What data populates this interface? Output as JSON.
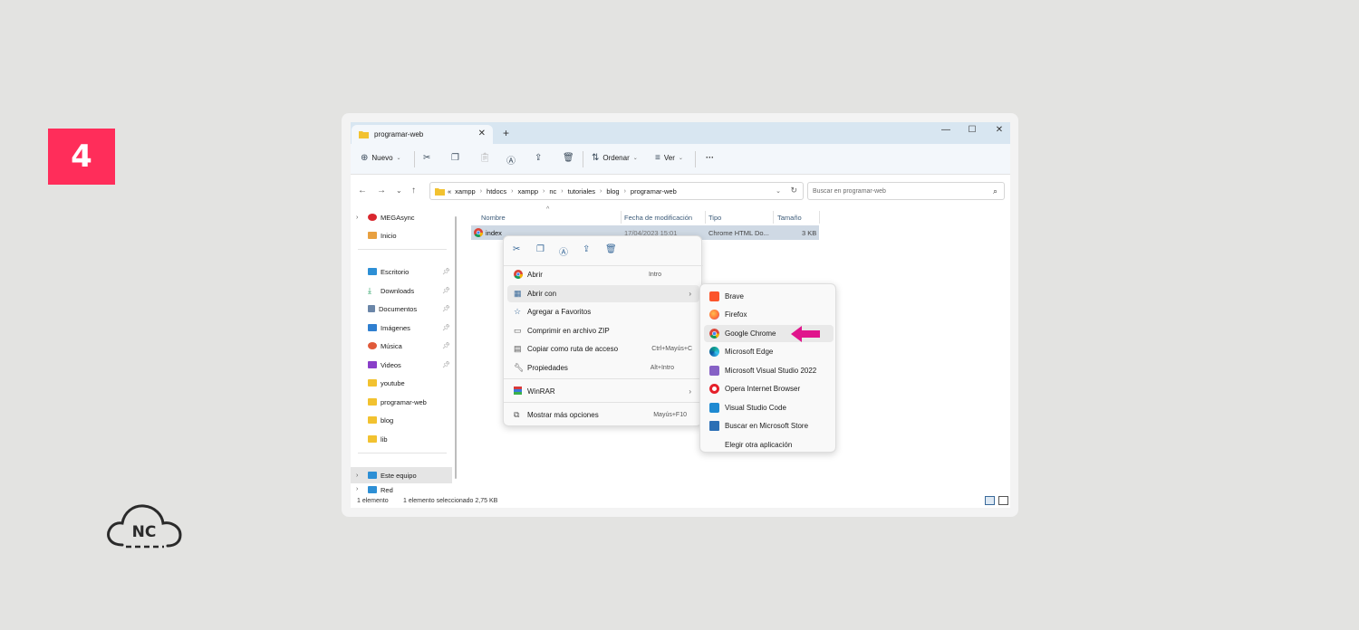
{
  "step": {
    "number": "4"
  },
  "logo": {
    "text": "NC"
  },
  "window": {
    "tab_title": "programar-web",
    "tab_close": "✕",
    "new_tab": "+",
    "controls": {
      "minimize": "—",
      "maximize": "☐",
      "close": "✕"
    }
  },
  "toolbar": {
    "new_label": "Nuevo",
    "sort_label": "Ordenar",
    "view_label": "Ver",
    "more_label": "···"
  },
  "address": {
    "breadcrumbs": [
      "«",
      "xampp",
      "htdocs",
      "xampp",
      "nc",
      "tutoriales",
      "blog",
      "programar-web"
    ],
    "search_placeholder": "Buscar en programar-web"
  },
  "sidebar": {
    "items": [
      {
        "label": "MEGAsync",
        "icon": "megasync-icon",
        "color": "#d9272e"
      },
      {
        "label": "Inicio",
        "icon": "home-icon",
        "color": "#e8a040"
      },
      {
        "label": "Escritorio",
        "icon": "desktop-icon",
        "color": "#2d8fd5"
      },
      {
        "label": "Downloads",
        "icon": "download-icon",
        "color": "#1a9a5a"
      },
      {
        "label": "Documentos",
        "icon": "document-icon",
        "color": "#6b86a8"
      },
      {
        "label": "Imágenes",
        "icon": "images-icon",
        "color": "#2f7fd0"
      },
      {
        "label": "Música",
        "icon": "music-icon",
        "color": "#e05a3a"
      },
      {
        "label": "Videos",
        "icon": "video-icon",
        "color": "#8a3fc9"
      },
      {
        "label": "youtube",
        "icon": "folder-icon",
        "color": "#f2c230"
      },
      {
        "label": "programar-web",
        "icon": "folder-icon",
        "color": "#f2c230"
      },
      {
        "label": "blog",
        "icon": "folder-icon",
        "color": "#f2c230"
      },
      {
        "label": "lib",
        "icon": "folder-icon",
        "color": "#f2c230"
      },
      {
        "label": "Este equipo",
        "icon": "computer-icon",
        "color": "#2d8fd5"
      },
      {
        "label": "Red",
        "icon": "network-icon",
        "color": "#2d8fd5"
      }
    ]
  },
  "columns": {
    "name": "Nombre",
    "modified": "Fecha de modificación",
    "type": "Tipo",
    "size": "Tamaño"
  },
  "file": {
    "name": "index",
    "modified": "17/04/2023 15:01",
    "type": "Chrome HTML Do...",
    "size": "3 KB"
  },
  "context_menu": {
    "items": [
      {
        "label": "Abrir",
        "shortcut": "Intro"
      },
      {
        "label": "Abrir con",
        "shortcut": ""
      },
      {
        "label": "Agregar a Favoritos",
        "shortcut": ""
      },
      {
        "label": "Comprimir en archivo ZIP",
        "shortcut": ""
      },
      {
        "label": "Copiar como ruta de acceso",
        "shortcut": "Ctrl+Mayús+C"
      },
      {
        "label": "Propiedades",
        "shortcut": "Alt+Intro"
      },
      {
        "label": "WinRAR",
        "shortcut": ""
      },
      {
        "label": "Mostrar más opciones",
        "shortcut": "Mayús+F10"
      }
    ]
  },
  "submenu": {
    "items": [
      {
        "label": "Brave",
        "color": "#fb542b"
      },
      {
        "label": "Firefox",
        "color": "#ff7139"
      },
      {
        "label": "Google Chrome",
        "color": "#4285f4"
      },
      {
        "label": "Microsoft Edge",
        "color": "#0f9d8a"
      },
      {
        "label": "Microsoft Visual Studio 2022",
        "color": "#8661c5"
      },
      {
        "label": "Opera Internet Browser",
        "color": "#e5202a"
      },
      {
        "label": "Visual Studio Code",
        "color": "#1f8ad2"
      },
      {
        "label": "Buscar en Microsoft Store",
        "color": "#2c6fb5"
      },
      {
        "label": "Elegir otra aplicación",
        "color": ""
      }
    ],
    "highlight_color": "#e0148c"
  },
  "status": {
    "count": "1 elemento",
    "selection": "1 elemento seleccionado  2,75 KB"
  }
}
